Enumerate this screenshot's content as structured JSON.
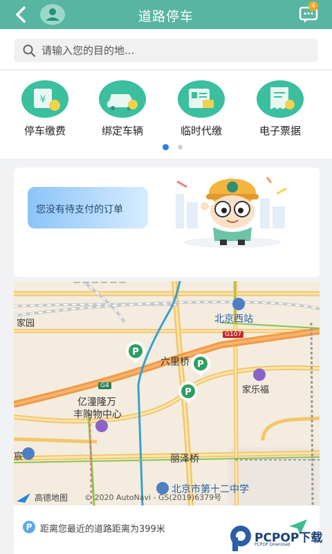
{
  "header": {
    "title": "道路停车",
    "message_badge": "4",
    "back_icon": "back-arrow-icon",
    "avatar_icon": "user-avatar-icon",
    "message_icon": "message-icon"
  },
  "search": {
    "placeholder": "请输入您的目的地..."
  },
  "quick_menu": {
    "items": [
      {
        "label": "停车缴费",
        "icon": "parking-payment-icon"
      },
      {
        "label": "绑定车辆",
        "icon": "bind-vehicle-icon"
      },
      {
        "label": "临时代缴",
        "icon": "proxy-payment-icon"
      },
      {
        "label": "电子票据",
        "icon": "e-receipt-icon"
      }
    ],
    "pager": {
      "active": 0,
      "count": 2
    }
  },
  "order_card": {
    "message": "您没有待支付的订单"
  },
  "map": {
    "labels": {
      "beijing_west": "北京西站",
      "road_g107": "G107",
      "road_g4": "G4",
      "liulitang": "六里桥",
      "jialefu": "家乐福",
      "yitongwanfeng": "亿潼隆万",
      "fengshopping": "丰购物中心",
      "lizeqiao": "丽泽桥",
      "school": "北京市第十二中学",
      "jiayuan": "家园",
      "left_edge": "宸",
      "top_partial": "一 一 一 一 一 一"
    },
    "copyright": "© 2020 AutoNavi - GS(2019)6379号",
    "brand": "高德地图",
    "accent": "#58b5a1"
  },
  "bottom": {
    "p_label": "P",
    "distance_text": "距离您最近的道路距离为399米"
  },
  "watermark": {
    "text": "PCPOP下载",
    "sub": "PCPOP Download"
  },
  "colors": {
    "header": "#58b5a1",
    "accent_green": "#3bbf9e",
    "page_bg": "#f1f2f4"
  }
}
